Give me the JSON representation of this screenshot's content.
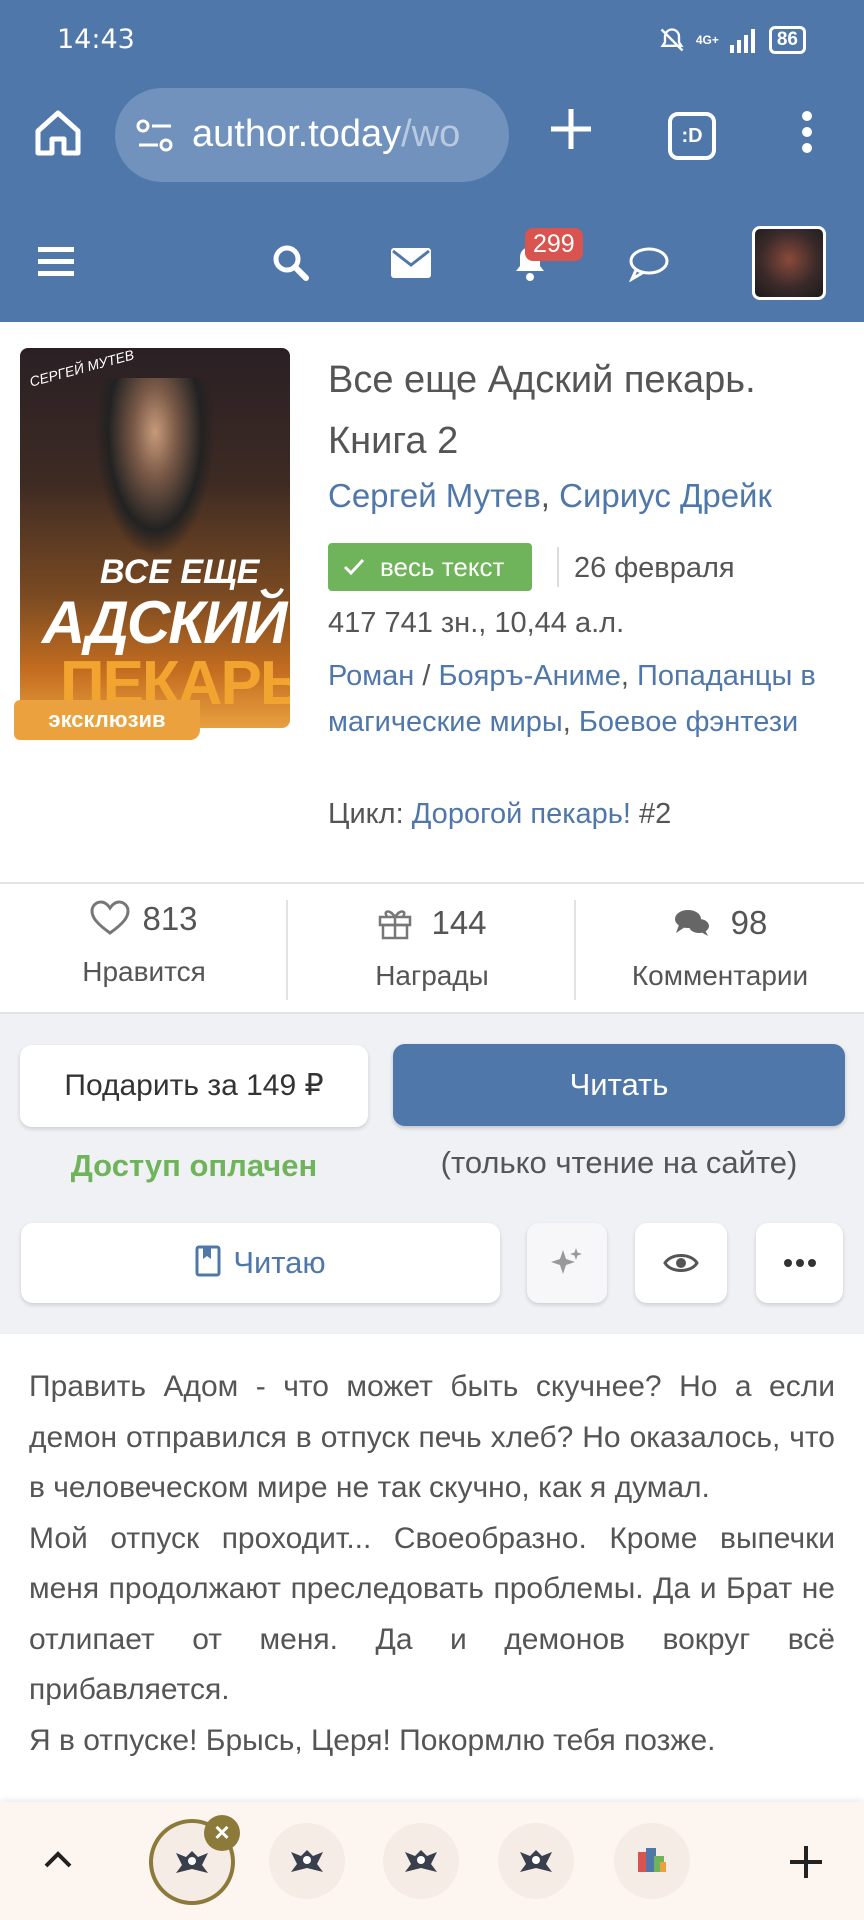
{
  "status_bar": {
    "time": "14:43",
    "network": "4G+",
    "battery": "86"
  },
  "browser": {
    "url_host": "author.today",
    "url_path": "/wo",
    "tabs_label": ":D"
  },
  "navbar": {
    "notification_count": "299"
  },
  "book": {
    "cover": {
      "author_text": "СЕРГЕЙ МУТЕВ",
      "line1": "ВСЕ ЕЩЕ",
      "line2": "АДСКИЙ",
      "line3": "ПЕКАРЬ",
      "badge": "эксклюзив"
    },
    "title": "Все еще Адский пекарь. Книга 2",
    "authors": [
      "Сергей Мутев",
      "Сириус Дрейк"
    ],
    "author_separator": ",",
    "status_badge": "весь текст",
    "date": "26 февраля",
    "stats": "417 741 зн., 10,44 а.л.",
    "genres": [
      "Роман",
      "Бояръ-Аниме",
      "Попаданцы в магические миры",
      "Боевое фэнтези"
    ],
    "cycle_label": "Цикл:",
    "cycle_name": "Дорогой пекарь!",
    "cycle_number": "#2"
  },
  "counters": [
    {
      "value": "813",
      "label": "Нравится",
      "icon": "heart-icon"
    },
    {
      "value": "144",
      "label": "Награды",
      "icon": "gift-icon"
    },
    {
      "value": "98",
      "label": "Комментарии",
      "icon": "comments-icon"
    }
  ],
  "actions": {
    "gift_label": "Подарить за 149 ₽",
    "read_label": "Читать",
    "paid_text": "Доступ оплачен",
    "readonly_text": "(только чтение на сайте)",
    "reading_label": "Читаю"
  },
  "description": [
    "Править Адом - что может быть скучнее? Но а если демон отправился в отпуск печь хлеб? Но оказалось, что в человеческом мире не так скучно, как я думал.",
    "Мой отпуск проходит... Своеобразно. Кроме вы­печки меня продолжают преследовать проблемы. Да и Брат не отлипает от меня. Да и демонов во­круг всё прибавляется.",
    "Я в отпуске! Брысь, Церя! Покормлю тебя позже."
  ],
  "colors": {
    "brand_blue": "#4f77aa",
    "success_green": "#6fb35a",
    "exclusive_orange": "#eba23e",
    "badge_red": "#d9534f"
  }
}
